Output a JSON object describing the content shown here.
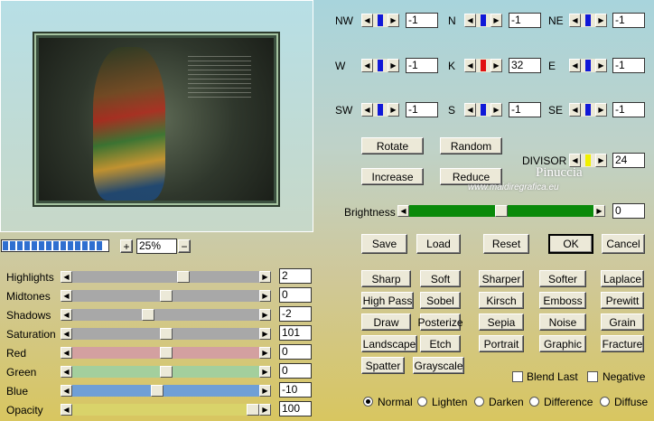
{
  "preview": {
    "zoom": "25%",
    "progress_segments": 14
  },
  "kernel": [
    {
      "label": "NW",
      "value": "-1",
      "color": "#1018d8"
    },
    {
      "label": "N",
      "value": "-1",
      "color": "#1018d8"
    },
    {
      "label": "NE",
      "value": "-1",
      "color": "#1018d8"
    },
    {
      "label": "W",
      "value": "-1",
      "color": "#1018d8"
    },
    {
      "label": "K",
      "value": "32",
      "color": "#e01010"
    },
    {
      "label": "E",
      "value": "-1",
      "color": "#1018d8"
    },
    {
      "label": "SW",
      "value": "-1",
      "color": "#1018d8"
    },
    {
      "label": "S",
      "value": "-1",
      "color": "#1018d8"
    },
    {
      "label": "SE",
      "value": "-1",
      "color": "#1018d8"
    }
  ],
  "buttons": {
    "rotate": "Rotate",
    "random": "Random",
    "increase": "Increase",
    "reduce": "Reduce",
    "save": "Save",
    "load": "Load",
    "reset": "Reset",
    "ok": "OK",
    "cancel": "Cancel",
    "plus": "+",
    "minus": "−"
  },
  "divisor": {
    "label": "DIVISOR",
    "value": "24",
    "color": "#f0f000"
  },
  "brightness": {
    "label": "Brightness",
    "value": "0",
    "level": 0.5,
    "color": "#0a8a0a"
  },
  "adjust": [
    {
      "label": "Highlights",
      "value": "2",
      "level": 0.6,
      "color": "#a8a8a8"
    },
    {
      "label": "Midtones",
      "value": "0",
      "level": 0.5,
      "color": "#a8a8a8"
    },
    {
      "label": "Shadows",
      "value": "-2",
      "level": 0.4,
      "color": "#a8a8a8"
    },
    {
      "label": "Saturation",
      "value": "101",
      "level": 0.5,
      "color": "#a8a8a8"
    },
    {
      "label": "Red",
      "value": "0",
      "level": 0.5,
      "color": "#d3a0a0"
    },
    {
      "label": "Green",
      "value": "0",
      "level": 0.5,
      "color": "#a3cf9d"
    },
    {
      "label": "Blue",
      "value": "-10",
      "level": 0.45,
      "color": "#6f9fd6"
    },
    {
      "label": "Opacity",
      "value": "100",
      "level": 1.0,
      "color": "#d9d36a"
    }
  ],
  "filters": [
    [
      "Sharp",
      "Soft",
      "Sharper",
      "Softer",
      "Laplace"
    ],
    [
      "High Pass",
      "Sobel",
      "Kirsch",
      "Emboss",
      "Prewitt"
    ],
    [
      "Draw",
      "Posterize",
      "Sepia",
      "Noise",
      "Grain"
    ],
    [
      "Landscape",
      "Etch",
      "Portrait",
      "Graphic",
      "Fracture"
    ],
    [
      "Spatter",
      "Grayscale"
    ]
  ],
  "checks": {
    "blend_last": "Blend Last",
    "negative": "Negative"
  },
  "modes": {
    "selected": "Normal",
    "options": [
      "Normal",
      "Lighten",
      "Darken",
      "Difference",
      "Diffuse"
    ]
  },
  "watermark": {
    "name": "Pinuccia",
    "site": "www.maidiregrafica.eu"
  }
}
